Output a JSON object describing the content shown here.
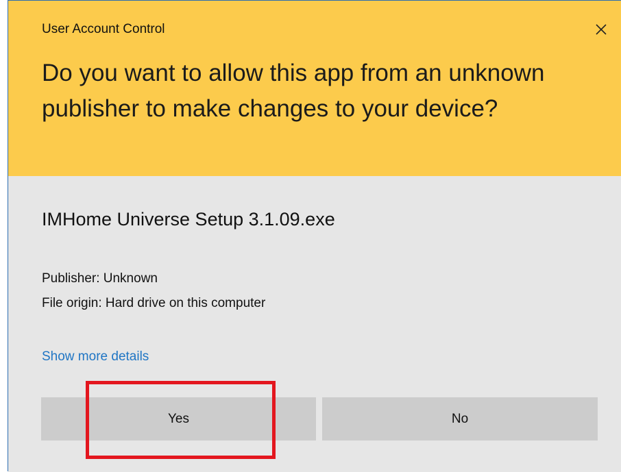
{
  "dialog": {
    "title": "User Account Control",
    "question": "Do you want to allow this app from an unknown publisher to make changes to your device?",
    "close_icon": "close-icon"
  },
  "app": {
    "name": "IMHome Universe Setup 3.1.09.exe",
    "publisher": "Publisher: Unknown",
    "origin": "File origin: Hard drive on this computer"
  },
  "links": {
    "more_details": "Show more details"
  },
  "buttons": {
    "yes_label": "Yes",
    "no_label": "No"
  },
  "colors": {
    "header_bg": "#fccb4c",
    "body_bg": "#e6e6e6",
    "button_bg": "#cccccc",
    "link": "#1f75c4",
    "highlight": "#e3161e"
  }
}
